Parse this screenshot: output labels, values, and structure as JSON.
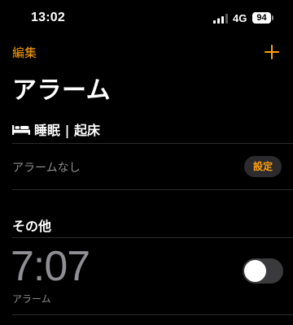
{
  "status_bar": {
    "time": "13:02",
    "network": "4G",
    "battery": "94"
  },
  "nav": {
    "edit_label": "編集",
    "add_icon": "plus-icon"
  },
  "title": "アラーム",
  "sleep_section": {
    "icon": "bed-icon",
    "title": "睡眠 | 起床",
    "no_alarm_text": "アラームなし",
    "set_button_label": "設定"
  },
  "other_section": {
    "title": "その他",
    "alarms": [
      {
        "time": "7:07",
        "label": "アラーム",
        "enabled": false
      }
    ]
  },
  "colors": {
    "accent": "#ff9f0a",
    "background": "#000000",
    "secondary_text": "#8e8e93",
    "separator": "#2c2c2e"
  }
}
